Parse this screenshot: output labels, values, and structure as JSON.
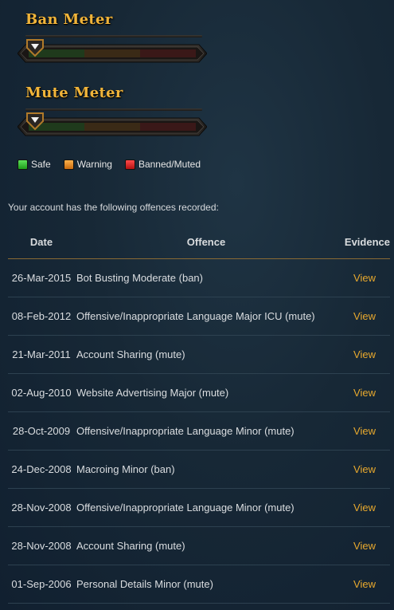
{
  "meters": {
    "ban": {
      "title": "Ban Meter",
      "level": 0
    },
    "mute": {
      "title": "Mute Meter",
      "level": 0
    }
  },
  "legend": {
    "safe": "Safe",
    "warning": "Warning",
    "banned": "Banned/Muted"
  },
  "colors": {
    "accent": "#f0b43a",
    "link": "#e8a92e",
    "safe": "#2fb52b",
    "warning": "#e0862a",
    "banned": "#d02424"
  },
  "intro": "Your account has the following offences recorded:",
  "table": {
    "headers": {
      "date": "Date",
      "offence": "Offence",
      "evidence": "Evidence"
    },
    "rows": [
      {
        "date": "26-Mar-2015",
        "offence": "Bot Busting Moderate (ban)",
        "evidence": "View"
      },
      {
        "date": "08-Feb-2012",
        "offence": "Offensive/Inappropriate Language Major ICU (mute)",
        "evidence": "View"
      },
      {
        "date": "21-Mar-2011",
        "offence": "Account Sharing (mute)",
        "evidence": "View"
      },
      {
        "date": "02-Aug-2010",
        "offence": "Website Advertising Major (mute)",
        "evidence": "View"
      },
      {
        "date": "28-Oct-2009",
        "offence": "Offensive/Inappropriate Language Minor (mute)",
        "evidence": "View"
      },
      {
        "date": "24-Dec-2008",
        "offence": "Macroing Minor (ban)",
        "evidence": "View"
      },
      {
        "date": "28-Nov-2008",
        "offence": "Offensive/Inappropriate Language Minor (mute)",
        "evidence": "View"
      },
      {
        "date": "28-Nov-2008",
        "offence": "Account Sharing (mute)",
        "evidence": "View"
      },
      {
        "date": "01-Sep-2006",
        "offence": "Personal Details Minor (mute)",
        "evidence": "View"
      }
    ]
  }
}
